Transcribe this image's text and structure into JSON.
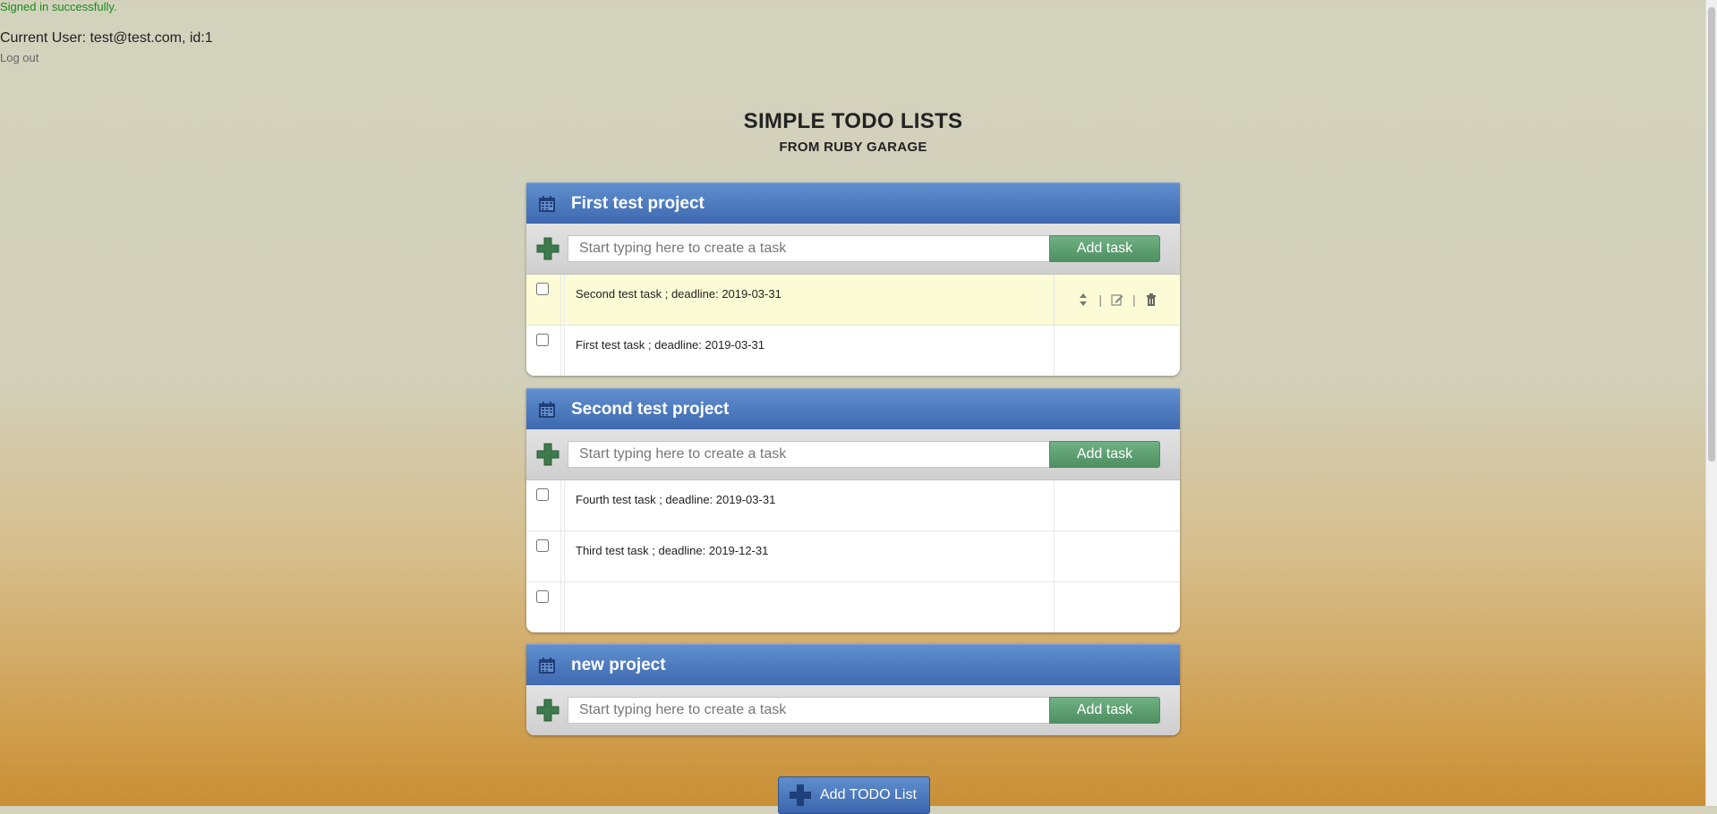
{
  "flash": "Signed in successfully.",
  "user": "Current User: test@test.com, id:1",
  "logout": "Log out",
  "title": "SIMPLE TODO LISTS",
  "subtitle": "FROM RUBY GARAGE",
  "placeholder": "Start typing here to create a task",
  "add_task_label": "Add task",
  "add_list_label": "Add TODO List",
  "colors": {
    "header": "#4a78be",
    "add_button": "#5fa073",
    "highlight_row": "#fbfbd5"
  },
  "projects": [
    {
      "title": "First test project",
      "tasks": [
        "Second test task ; deadline: 2019-03-31",
        "First test task ; deadline: 2019-03-31"
      ]
    },
    {
      "title": "Second test project",
      "tasks": [
        "Fourth test task ; deadline: 2019-03-31",
        "Third test task ; deadline: 2019-12-31",
        ""
      ]
    },
    {
      "title": "new project",
      "tasks": []
    }
  ]
}
